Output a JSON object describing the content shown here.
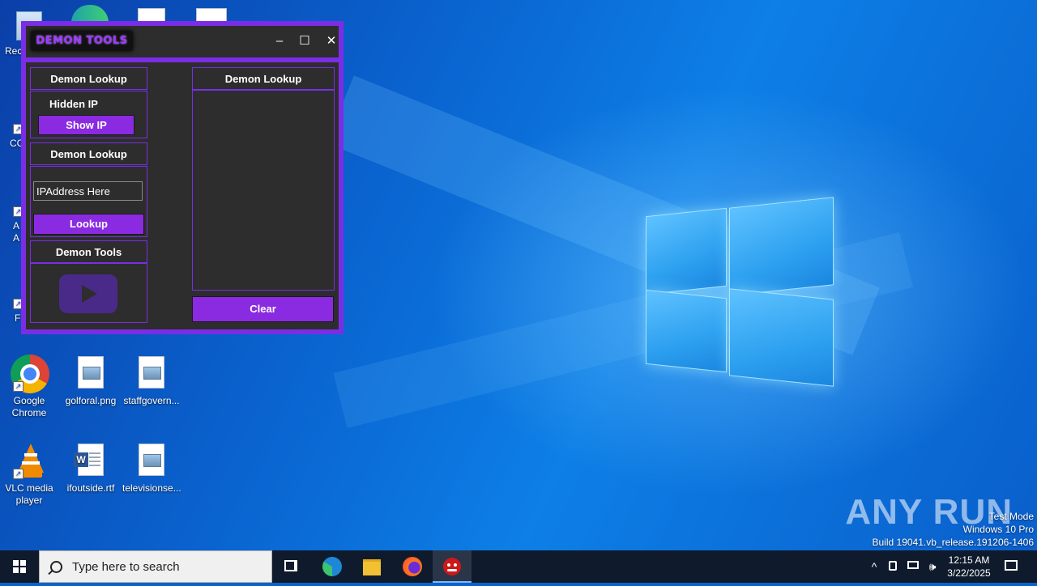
{
  "desktop": {
    "icons": [
      {
        "label": "Rec",
        "kind": "recycle"
      },
      {
        "label": "CC",
        "kind": "app"
      },
      {
        "label": "A\nA",
        "kind": "app-red"
      },
      {
        "label": "F",
        "kind": "app-orange"
      },
      {
        "label": "Google\nChrome",
        "kind": "chrome"
      },
      {
        "label": "golforal.png",
        "kind": "image"
      },
      {
        "label": "staffgovern...",
        "kind": "image"
      },
      {
        "label": "VLC media\nplayer",
        "kind": "vlc"
      },
      {
        "label": "ifoutside.rtf",
        "kind": "word"
      },
      {
        "label": "televisionse...",
        "kind": "image"
      }
    ],
    "watermark": {
      "logo": "ANY RUN",
      "lines": [
        "Test Mode",
        "Windows 10 Pro",
        "Build 19041.vb_release.191206-1406"
      ]
    }
  },
  "window": {
    "logo_text": "DEMON TOOLS",
    "controls": {
      "minimize": "–",
      "maximize": "☐",
      "close": "✕"
    },
    "hidden_ip": {
      "header": "Demon Lookup",
      "label": "Hidden IP",
      "button": "Show IP"
    },
    "lookup": {
      "header": "Demon Lookup",
      "input_value": "IPAddress Here",
      "button": "Lookup"
    },
    "tools": {
      "header": "Demon Tools",
      "play_icon": "youtube-play"
    },
    "output": {
      "header": "Demon Lookup",
      "text": "",
      "clear_button": "Clear"
    },
    "accent_color": "#7b2de6",
    "button_color": "#8a2be2"
  },
  "taskbar": {
    "search_placeholder": "Type here to search",
    "pinned": [
      "task-view",
      "edge",
      "file-explorer",
      "firefox",
      "demon-tools"
    ],
    "tray": {
      "time": "12:15 AM",
      "date": "3/22/2025"
    }
  }
}
